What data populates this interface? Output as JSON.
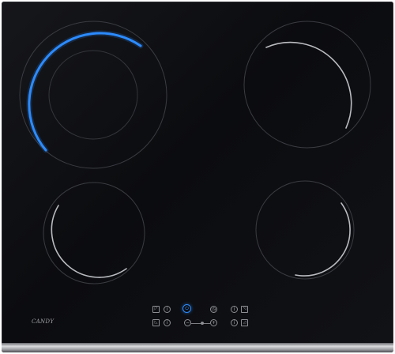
{
  "brand": {
    "logo_text": "CANDY"
  },
  "colors": {
    "glass": "#0e0f13",
    "zone_ring": "#b9bbc0",
    "active_indicator": "#2d8cff",
    "frame": "#c8c9cc"
  },
  "zones": {
    "front_left_active": true
  },
  "controls": {
    "power_symbol": "⏻",
    "plus_symbol": "+",
    "minus_symbol": "−",
    "timer_symbol": "◷"
  }
}
